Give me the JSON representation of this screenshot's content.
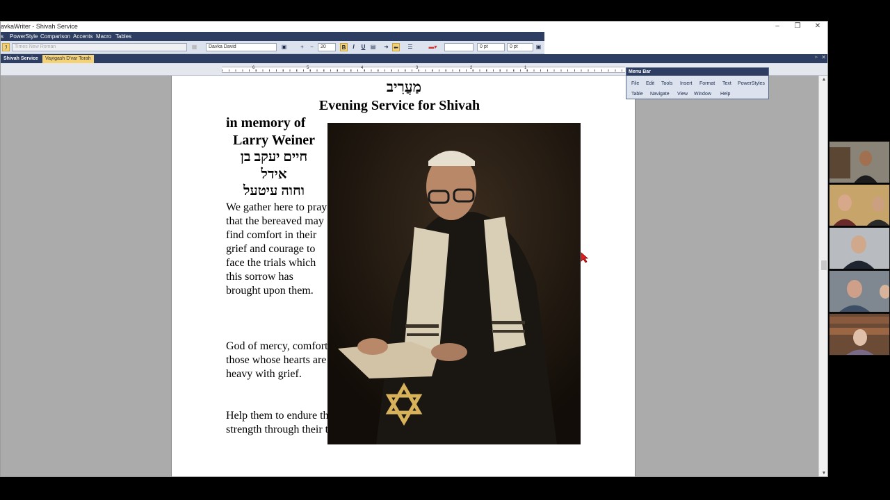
{
  "window": {
    "title": "avkaWriter - Shivah Service",
    "minimize": "–",
    "restore": "❐",
    "close": "✕"
  },
  "menubar": {
    "items": [
      "s",
      "PowerStyle",
      "Comparison",
      "Accents",
      "Macro",
      "Tables"
    ]
  },
  "toolbar": {
    "style_glyph": "ℐ",
    "font_latin": "Times New Roman",
    "font_hebrew": "Davka David",
    "font_size": "20",
    "bold": "B",
    "italic": "I",
    "underline": "U",
    "space_before": "0 pt",
    "space_after": "0 pt",
    "plus": "+",
    "minus": "−"
  },
  "tabs": {
    "active": "Shivah Service",
    "other": "Vayigash D'var Torah",
    "close": "✕",
    "pin": "▹"
  },
  "ruler": {
    "numbers": [
      "6",
      "5",
      "4",
      "3",
      "2",
      "1"
    ]
  },
  "document": {
    "hebrew_title": "מַעֲרִיב",
    "heading": "Evening Service for Shivah",
    "memory_line1": "in memory of",
    "memory_line2": "Larry Weiner",
    "memory_heb1": "חיים יעקב בן",
    "memory_heb2": "אידל",
    "memory_heb3": "וחוה עיטעל",
    "para1": "We gather here to pray that the bereaved may find comfort in their grief and courage to face the trials which this sorrow has brought upon them.",
    "para2": "God of mercy, comfort those whose hearts are heavy with grief.",
    "para3": "Help them to endure their sorrow and to find strength through their trust in You.   Amen"
  },
  "menu_palette": {
    "title": "Menu Bar",
    "row1": [
      "File",
      "Edit",
      "Tools",
      "Insert",
      "Format",
      "Text",
      "PowerStyles"
    ],
    "row2": [
      "Table",
      "Navigate",
      "View",
      "Window",
      "Help"
    ]
  },
  "scrollbar": {
    "up": "▲",
    "down": "▼"
  },
  "colors": {
    "menubar": "#2d3e62",
    "toolbar": "#dde3ee",
    "workspace": "#ababab",
    "tab_highlight": "#f3d27a"
  }
}
